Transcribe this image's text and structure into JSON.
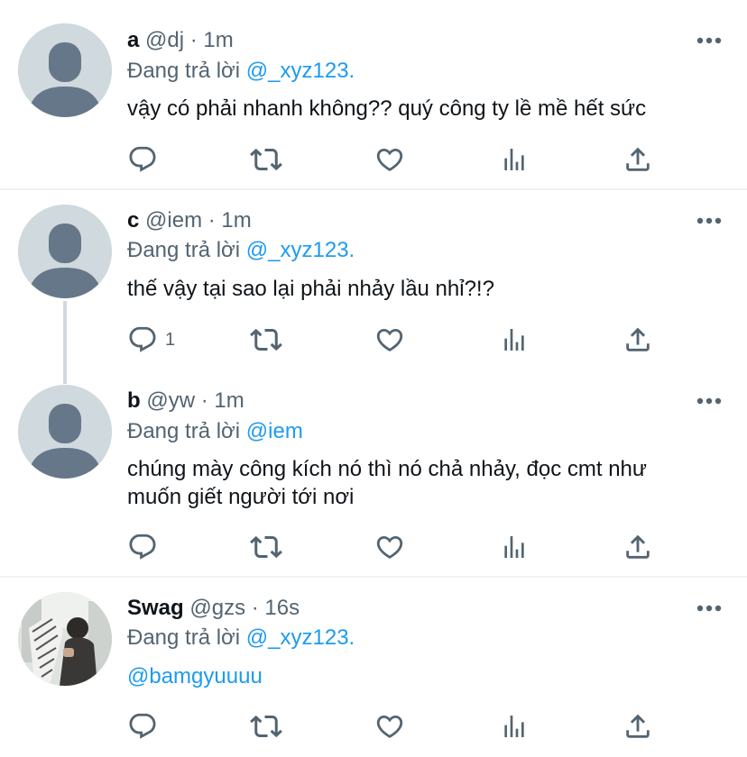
{
  "colors": {
    "accent": "#1d9bf0",
    "secondary_text": "#536471",
    "divider": "#eff3f4",
    "avatar_placeholder": "#cfd9de"
  },
  "tweets": [
    {
      "name": "a",
      "handle": "@dj",
      "separator": "·",
      "time": "1m",
      "replying_label": "Đang trả lời",
      "replying_to": "@_xyz123.",
      "text": "vậy có phải nhanh không?? quý công ty lề mề hết sức",
      "reply_count": "",
      "avatar": "default-avatar-icon"
    },
    {
      "name": "c",
      "handle": "@iem",
      "separator": "·",
      "time": "1m",
      "replying_label": "Đang trả lời",
      "replying_to": "@_xyz123.",
      "text": "thế vậy tại sao lại phải nhảy lầu nhỉ?!?",
      "reply_count": "1",
      "avatar": "default-avatar-icon"
    },
    {
      "name": "b",
      "handle": "@yw",
      "separator": "·",
      "time": "1m",
      "replying_label": "Đang trả lời",
      "replying_to": "@iem",
      "text": "chúng mày công kích nó thì nó chả nhảy, đọc cmt như muốn giết người tới nơi",
      "reply_count": "",
      "avatar": "default-avatar-icon"
    },
    {
      "name": "Swag",
      "handle": "@gzs",
      "separator": "·",
      "time": "16s",
      "replying_label": "Đang trả lời",
      "replying_to": "@_xyz123.",
      "text": "@bamgyuuuu",
      "reply_count": "",
      "avatar": "photo-avatar"
    }
  ]
}
